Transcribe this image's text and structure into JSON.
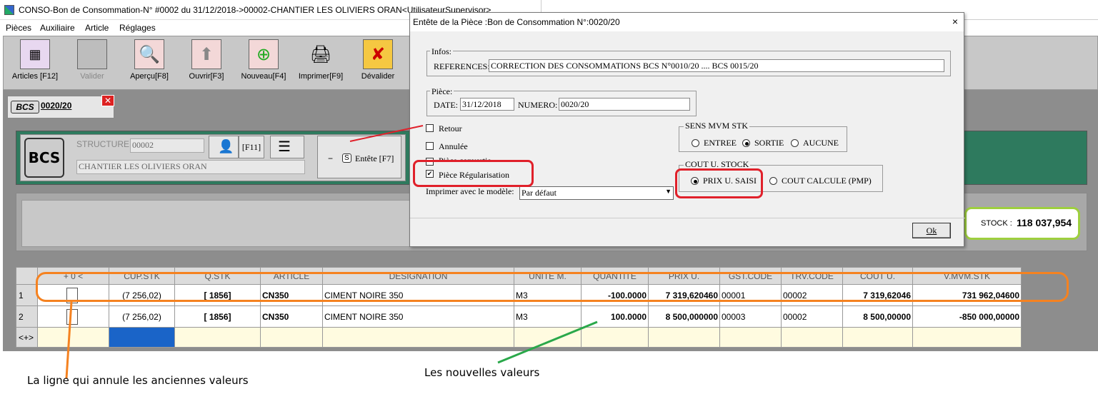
{
  "window": {
    "title": "CONSO-Bon de Consommation-N° #0002 du 31/12/2018->00002-CHANTIER LES OLIVIERS ORAN<UtilisateurSupervisor>"
  },
  "menu": [
    "Pièces",
    "Auxiliaire",
    "Article",
    "Réglages"
  ],
  "toolbar": [
    {
      "label": "Articles [F12]",
      "icon": "grid-icon"
    },
    {
      "label": "Valider",
      "icon": "validate-icon"
    },
    {
      "label": "Aperçu[F8]",
      "icon": "preview-icon"
    },
    {
      "label": "Ouvrir[F3]",
      "icon": "open-icon"
    },
    {
      "label": "Nouveau[F4]",
      "icon": "new-icon"
    },
    {
      "label": "Imprimer[F9]",
      "icon": "printer-icon"
    },
    {
      "label": "Dévalider",
      "icon": "invalidate-icon"
    }
  ],
  "tab": {
    "badge": "BCS",
    "title": "0020/20"
  },
  "header": {
    "badge": "BCS",
    "structure_label": "STRUCTURE:",
    "structure_code": "00002",
    "structure_name": "CHANTIER LES OLIVIERS ORAN",
    "f11_label": "[F11]",
    "entete_label": "Entête [F7]",
    "s_label": "S"
  },
  "stock": {
    "label": "STOCK :",
    "value": "118 037,954"
  },
  "grid": {
    "headers": [
      "+ 0 <",
      "CUP.STK",
      "Q.STK",
      "ARTICLE",
      "DESIGNATION",
      "UNITE M.",
      "QUANTITE",
      "PRIX U.",
      "GST.CODE",
      "TRV.CODE",
      "COUT U.",
      "V.MVM.STK"
    ],
    "rows": [
      {
        "n": "1",
        "cup": "(7 256,02)",
        "qstk": "[ 1856]",
        "article": "CN350",
        "designation": "CIMENT NOIRE 350",
        "unite": "M3",
        "quantite": "-100.0000",
        "prix": "7 319,620460",
        "gst": "00001",
        "trv": "00002",
        "cout": "7 319,62046",
        "vmvm": "731 962,04600"
      },
      {
        "n": "2",
        "cup": "(7 256,02)",
        "qstk": "[ 1856]",
        "article": "CN350",
        "designation": "CIMENT NOIRE 350",
        "unite": "M3",
        "quantite": "100.0000",
        "prix": "8 500,000000",
        "gst": "00003",
        "trv": "00002",
        "cout": "8 500,00000",
        "vmvm": "-850 000,00000"
      }
    ],
    "new_row": "<+>"
  },
  "dialog": {
    "title": "Entête de la Pièce :Bon de Consommation N°:0020/20",
    "close": "×",
    "infos_label": "Infos:",
    "references_label": "REFERENCES:",
    "references_value": "CORRECTION DES CONSOMMATIONS BCS N°0010/20 .... BCS  0015/20",
    "piece_label": "Pièce:",
    "date_label": "DATE:",
    "date_value": "31/12/2018",
    "numero_label": "NUMERO:",
    "numero_value": "0020/20",
    "retour": "Retour",
    "annulee": "Annulée",
    "piece_convertie": "Pièce convertie",
    "piece_regularisation": "Pièce Régularisation",
    "imprimer_label": "Imprimer avec le modèle:",
    "modele_value": "Par défaut",
    "sens_label": "SENS MVM STK",
    "sens_options": [
      "ENTREE",
      "SORTIE",
      "AUCUNE"
    ],
    "sens_selected": "SORTIE",
    "cout_label": "COUT U. STOCK",
    "cout_options": [
      "PRIX U. SAISI",
      "COUT CALCULE (PMP)"
    ],
    "cout_selected": "PRIX U. SAISI",
    "ok_label": "Ok"
  },
  "annotations": {
    "left_note": "La ligne qui annule les anciennes valeurs",
    "right_note": "Les nouvelles valeurs"
  },
  "colors": {
    "highlight_red": "#e0202a",
    "highlight_orange": "#f58220",
    "highlight_green": "#9ecf3e",
    "arrow_green": "#2aa84a",
    "panel_green": "#2e7a5e"
  }
}
